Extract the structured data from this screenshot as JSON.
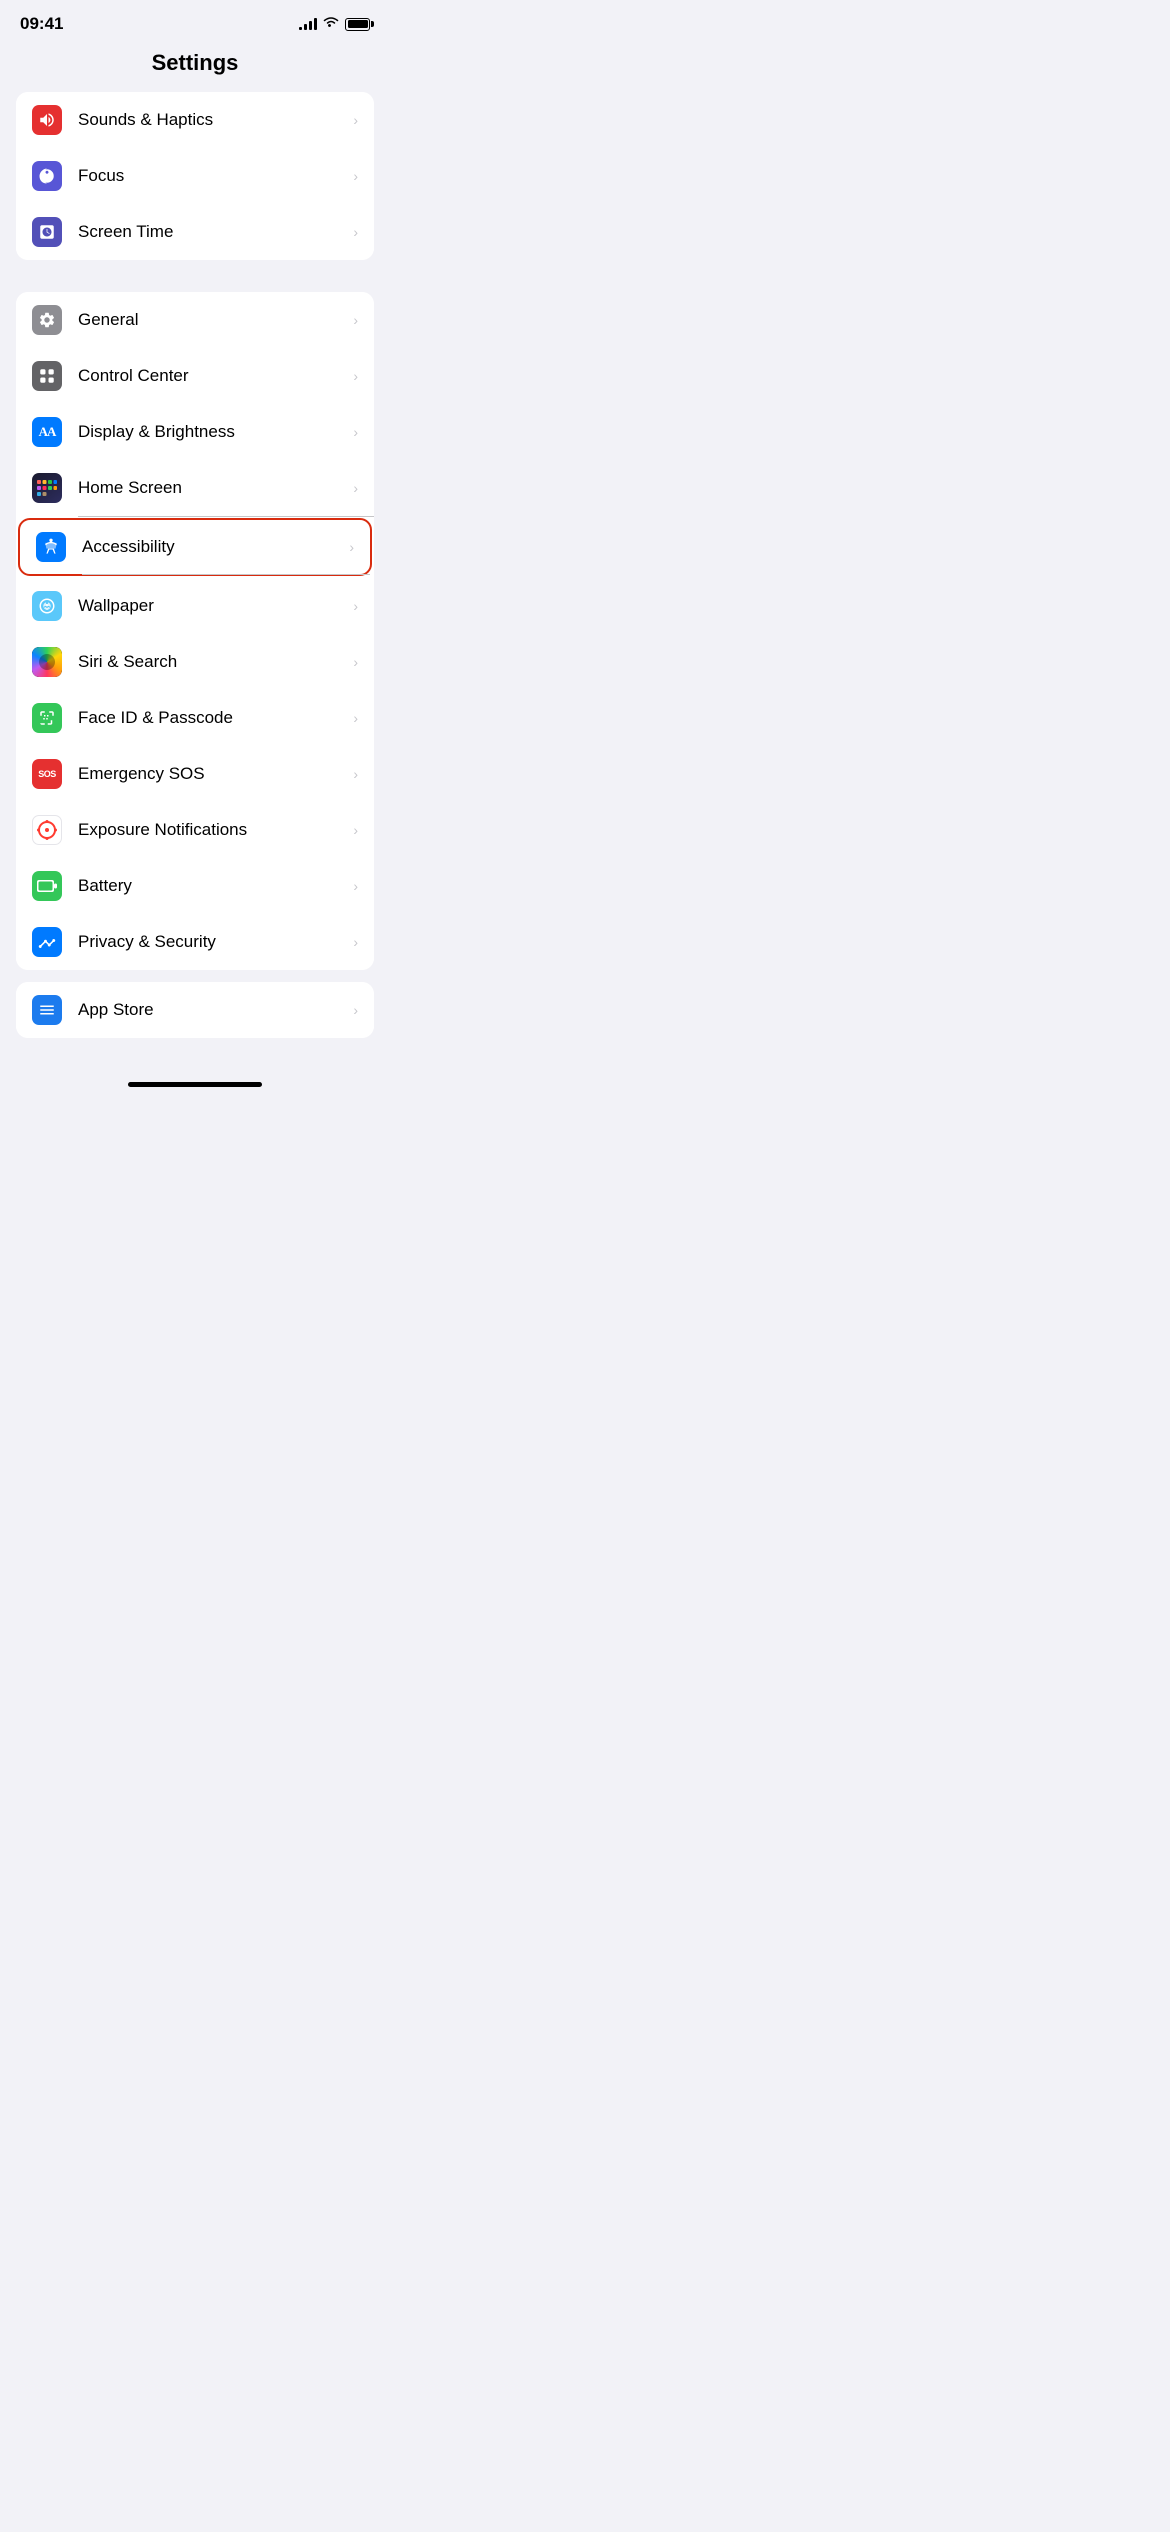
{
  "statusBar": {
    "time": "09:41",
    "battery": "full"
  },
  "pageTitle": "Settings",
  "groups": [
    {
      "id": "group1",
      "items": [
        {
          "id": "sounds-haptics",
          "label": "Sounds & Haptics",
          "iconColor": "icon-red",
          "iconSymbol": "🔊"
        },
        {
          "id": "focus",
          "label": "Focus",
          "iconColor": "icon-purple",
          "iconSymbol": "🌙"
        },
        {
          "id": "screen-time",
          "label": "Screen Time",
          "iconColor": "icon-indigo",
          "iconSymbol": "⏳"
        }
      ]
    },
    {
      "id": "group2",
      "items": [
        {
          "id": "general",
          "label": "General",
          "iconColor": "icon-gray",
          "iconSymbol": "⚙️"
        },
        {
          "id": "control-center",
          "label": "Control Center",
          "iconColor": "icon-dark-gray",
          "iconSymbol": "⊞"
        },
        {
          "id": "display-brightness",
          "label": "Display & Brightness",
          "iconColor": "icon-blue",
          "iconSymbol": "AA"
        },
        {
          "id": "home-screen",
          "label": "Home Screen",
          "iconColor": "icon-multicolor",
          "iconSymbol": "grid"
        },
        {
          "id": "accessibility",
          "label": "Accessibility",
          "iconColor": "icon-blue",
          "iconSymbol": "♿",
          "highlighted": true
        },
        {
          "id": "wallpaper",
          "label": "Wallpaper",
          "iconColor": "icon-wallpaper",
          "iconSymbol": "❋"
        },
        {
          "id": "siri-search",
          "label": "Siri & Search",
          "iconColor": "icon-siri",
          "iconSymbol": "siri"
        },
        {
          "id": "face-id",
          "label": "Face ID & Passcode",
          "iconColor": "icon-green-face",
          "iconSymbol": "face"
        },
        {
          "id": "emergency-sos",
          "label": "Emergency SOS",
          "iconColor": "icon-red-sos",
          "iconSymbol": "SOS"
        },
        {
          "id": "exposure",
          "label": "Exposure Notifications",
          "iconColor": "icon-exposure",
          "iconSymbol": "exposure"
        },
        {
          "id": "battery",
          "label": "Battery",
          "iconColor": "icon-green-battery",
          "iconSymbol": "battery"
        },
        {
          "id": "privacy-security",
          "label": "Privacy & Security",
          "iconColor": "icon-blue-hand",
          "iconSymbol": "hand"
        }
      ]
    }
  ],
  "partialItem": {
    "id": "app-store",
    "label": "App Store",
    "iconColor": "icon-blue-app"
  },
  "chevron": "›"
}
